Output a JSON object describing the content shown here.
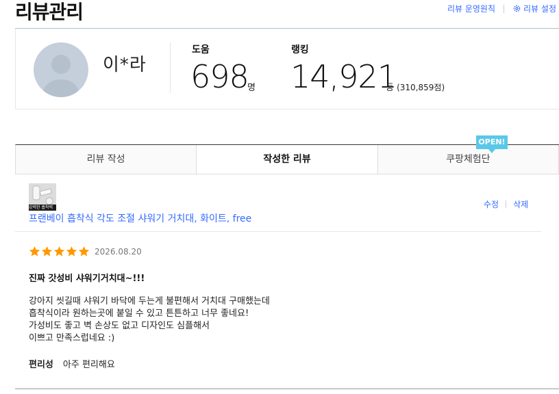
{
  "header": {
    "title": "리뷰관리",
    "links": {
      "policy": "리뷰 운영원칙",
      "settings": "리뷰 설정"
    }
  },
  "profile": {
    "nickname": "이*라",
    "help_label": "도움",
    "help_count": "698",
    "help_unit": "명",
    "rank_label": "랭킹",
    "rank": "14,921",
    "rank_unit": "등",
    "rank_total": "(310,859점)"
  },
  "tabs": [
    {
      "label": "리뷰 작성",
      "active": false
    },
    {
      "label": "작성한 리뷰",
      "active": true
    },
    {
      "label": "쿠팡체험단",
      "active": false
    }
  ],
  "badge": "OPEN!",
  "review": {
    "thumb_caption": "강력한 흡착력",
    "product": "프랜베이 흡착식 각도 조절 샤워기 거치대, 화이트, free",
    "edit": "수정",
    "delete": "삭제",
    "rating": 5,
    "date": "2026.08.20",
    "headline": "진짜 갓성비 샤워기거치대~!!!",
    "body_lines": [
      "강아지 씻길때 샤워기 바닥에 두는게 불편해서 거치대 구매했는데",
      "흡착식이라 원하는곳에 붙일 수 있고 튼튼하고 너무 좋네요!",
      "가성비도 좋고 벽 손상도 없고 디자인도 심플해서",
      "이쁘고 만족스럽네요 :)"
    ],
    "attr_label": "편리성",
    "attr_value": "아주 편리해요"
  },
  "colors": {
    "link": "#346aff",
    "star": "#ff9900",
    "badge": "#5ac8e8"
  }
}
